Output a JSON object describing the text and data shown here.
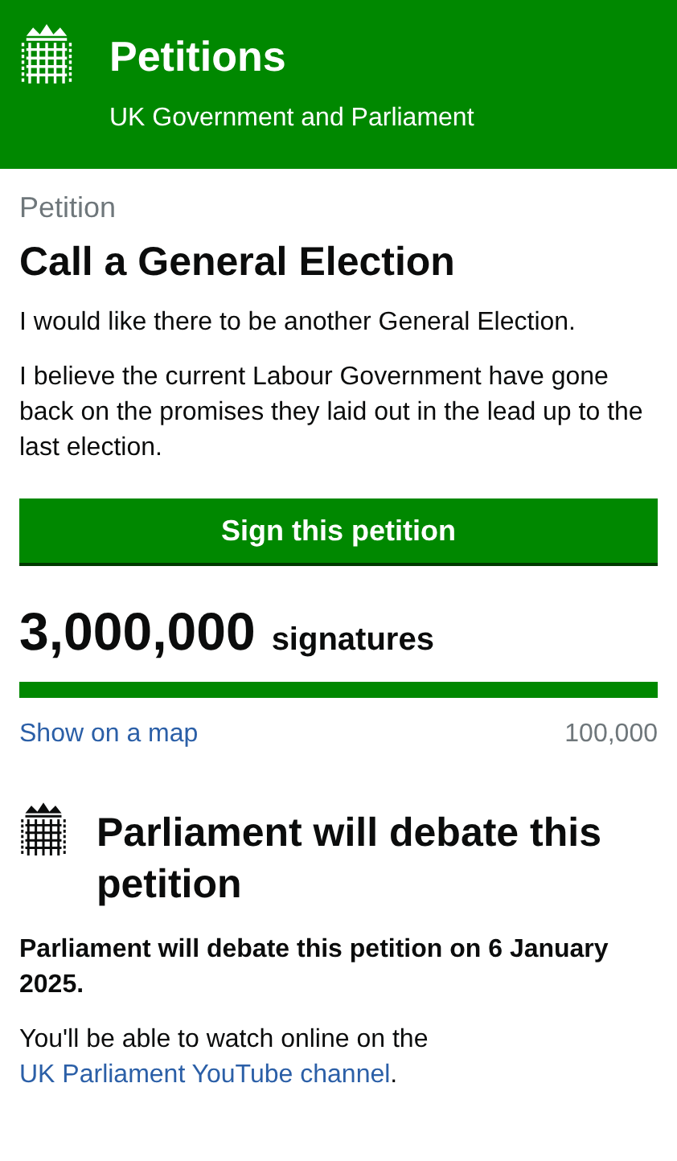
{
  "header": {
    "title": "Petitions",
    "subtitle": "UK Government and Parliament"
  },
  "petition": {
    "label": "Petition",
    "title": "Call a General Election",
    "paragraphs": [
      "I would like there to be another General Election.",
      "I believe the current Labour Government have gone back on the promises they laid out in the lead up to the last election."
    ],
    "sign_button": "Sign this petition"
  },
  "signatures": {
    "count": "3,000,000",
    "unit": "signatures",
    "level": 1,
    "map_link": "Show on a map",
    "threshold": "100,000"
  },
  "debate": {
    "heading": "Parliament will debate this petition",
    "date_text": "Parliament will debate this petition on 6 January 2025.",
    "watch_text": "You'll be able to watch online on the",
    "watch_link": "UK Parliament YouTube channel",
    "watch_end": "."
  }
}
